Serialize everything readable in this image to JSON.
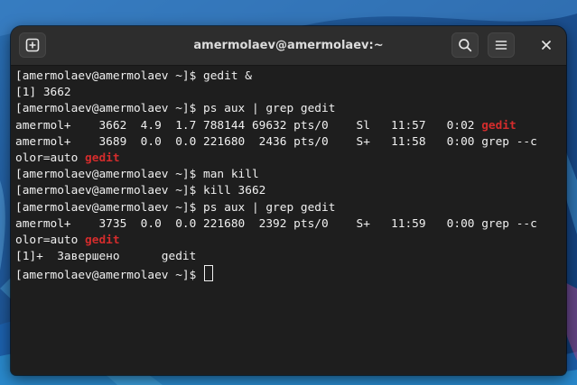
{
  "window": {
    "title": "amermolaev@amermolaev:~"
  },
  "titlebar": {
    "icons": {
      "new_tab": "new-tab-icon",
      "search": "search-icon",
      "menu": "hamburger-menu-icon",
      "close": "close-icon"
    }
  },
  "colors": {
    "terminal_bg": "#1e1e1e",
    "titlebar_bg": "#2d2d2d",
    "text": "#f0f0f0",
    "match_highlight": "#d42c2c"
  },
  "terminal": {
    "lines": [
      [
        {
          "t": "[amermolaev@amermolaev ~]$ gedit &"
        }
      ],
      [
        {
          "t": "[1] 3662"
        }
      ],
      [
        {
          "t": "[amermolaev@amermolaev ~]$ ps aux | grep gedit"
        }
      ],
      [
        {
          "t": "amermol+    3662  4.9  1.7 788144 69632 pts/0    Sl   11:57   0:02 "
        },
        {
          "t": "gedit",
          "hl": true
        }
      ],
      [
        {
          "t": "amermol+    3689  0.0  0.0 221680  2436 pts/0    S+   11:58   0:00 grep --c"
        }
      ],
      [
        {
          "t": "olor=auto "
        },
        {
          "t": "gedit",
          "hl": true
        }
      ],
      [
        {
          "t": "[amermolaev@amermolaev ~]$ man kill"
        }
      ],
      [
        {
          "t": "[amermolaev@amermolaev ~]$ kill 3662"
        }
      ],
      [
        {
          "t": "[amermolaev@amermolaev ~]$ ps aux | grep gedit"
        }
      ],
      [
        {
          "t": "amermol+    3735  0.0  0.0 221680  2392 pts/0    S+   11:59   0:00 grep --c"
        }
      ],
      [
        {
          "t": "olor=auto "
        },
        {
          "t": "gedit",
          "hl": true
        }
      ],
      [
        {
          "t": "[1]+  Завершено      gedit"
        }
      ],
      [
        {
          "t": "[amermolaev@amermolaev ~]$ "
        },
        {
          "cursor": true
        }
      ]
    ]
  }
}
